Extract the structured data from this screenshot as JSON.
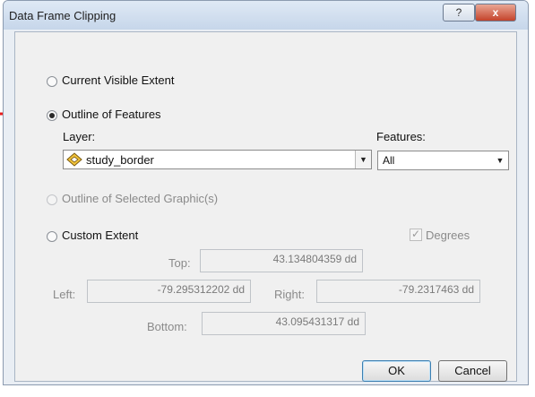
{
  "window": {
    "title": "Data Frame Clipping",
    "help_glyph": "?",
    "close_glyph": "x"
  },
  "options": {
    "current_visible_extent": "Current Visible Extent",
    "outline_of_features": "Outline of Features",
    "outline_selected_graphics": "Outline of Selected Graphic(s)",
    "custom_extent": "Custom Extent",
    "selected": "outline_of_features"
  },
  "layer": {
    "label": "Layer:",
    "value": "study_border",
    "icon": "layer-diamond-icon"
  },
  "features": {
    "label": "Features:",
    "value": "All"
  },
  "degrees": {
    "label": "Degrees",
    "checked": true,
    "check_glyph": "✓"
  },
  "extent": {
    "top_label": "Top:",
    "top_value": "43.134804359 dd",
    "left_label": "Left:",
    "left_value": "-79.295312202 dd",
    "right_label": "Right:",
    "right_value": "-79.2317463 dd",
    "bottom_label": "Bottom:",
    "bottom_value": "43.095431317 dd"
  },
  "buttons": {
    "ok": "OK",
    "cancel": "Cancel"
  },
  "annotation": {
    "arrow_color": "#e81c1c"
  },
  "colors": {
    "title_bar": "#c6d6ea",
    "close_button": "#c4432b",
    "client_bg": "#f0f0f0"
  }
}
